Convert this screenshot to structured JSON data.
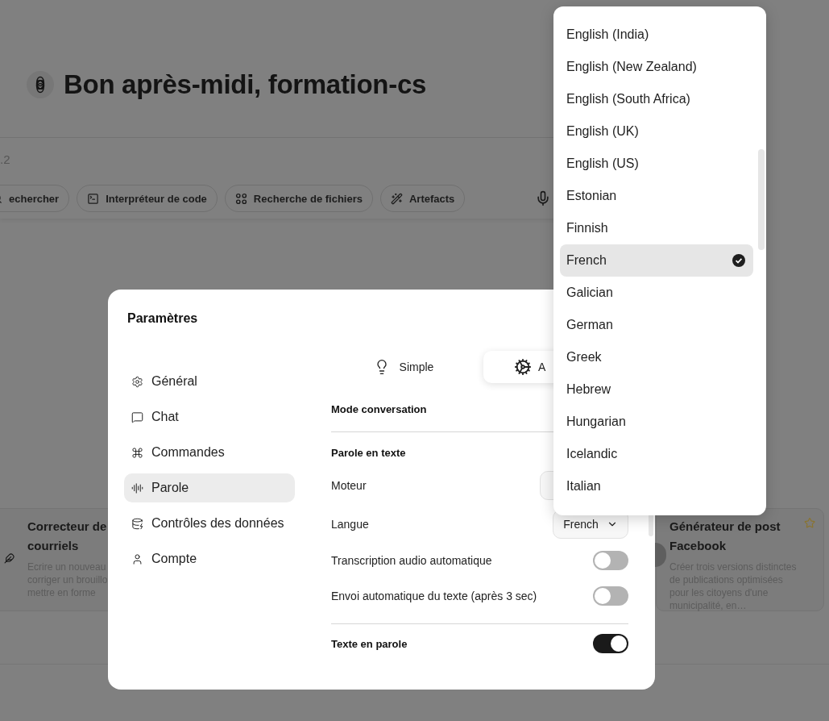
{
  "greeting": {
    "title": "Bon après-midi, formation-cs"
  },
  "composer": {
    "text": ".2",
    "tools": [
      {
        "label": "echercher",
        "kind": "search"
      },
      {
        "label": "Interpréteur de code",
        "kind": "terminal"
      },
      {
        "label": "Recherche de fichiers",
        "kind": "files"
      },
      {
        "label": "Artefacts",
        "kind": "wand"
      }
    ]
  },
  "cards": [
    {
      "kind": "pen",
      "title": "Correcteur de courriels",
      "description_lines": [
        "Ecrire un nouveau",
        "corriger un brouillo",
        "mettre en forme"
      ]
    },
    {
      "kind": "avatar",
      "title": "Générateur de post Facebook",
      "description_lines": [
        "Créer trois versions distinctes de publications optimisées pour les citoyens d'une municipalité, en…"
      ]
    }
  ],
  "settings": {
    "title": "Paramètres",
    "nav": [
      {
        "label": "Général",
        "kind": "general",
        "selected": false
      },
      {
        "label": "Chat",
        "kind": "chat",
        "selected": false
      },
      {
        "label": "Commandes",
        "kind": "commands",
        "selected": false
      },
      {
        "label": "Parole",
        "kind": "speech",
        "selected": true
      },
      {
        "label": "Contrôles des données",
        "kind": "data",
        "selected": false
      },
      {
        "label": "Compte",
        "kind": "account",
        "selected": false
      }
    ],
    "tabs": [
      {
        "label": "Simple",
        "kind": "bulb",
        "selected": false
      },
      {
        "label": "A",
        "kind": "gear",
        "selected": true
      }
    ],
    "rows": [
      {
        "kind": "section",
        "label": "Mode conversation"
      },
      {
        "kind": "section",
        "label": "Parole en texte",
        "divider_before": true
      },
      {
        "kind": "select",
        "label": "Moteur"
      },
      {
        "kind": "select",
        "label": "Langue",
        "value": "French"
      },
      {
        "kind": "toggle",
        "label": "Transcription audio automatique",
        "on": false
      },
      {
        "kind": "toggle",
        "label": "Envoi automatique du texte (après 3 sec)",
        "on": false
      },
      {
        "kind": "section_toggle",
        "label": "Texte en parole",
        "on": true,
        "divider_before": true
      }
    ]
  },
  "language_menu": {
    "items": [
      {
        "label": "English (India)",
        "selected": false
      },
      {
        "label": "English (New Zealand)",
        "selected": false
      },
      {
        "label": "English (South Africa)",
        "selected": false
      },
      {
        "label": "English (UK)",
        "selected": false
      },
      {
        "label": "English (US)",
        "selected": false
      },
      {
        "label": "Estonian",
        "selected": false
      },
      {
        "label": "Finnish",
        "selected": false
      },
      {
        "label": "French",
        "selected": true
      },
      {
        "label": "Galician",
        "selected": false
      },
      {
        "label": "German",
        "selected": false
      },
      {
        "label": "Greek",
        "selected": false
      },
      {
        "label": "Hebrew",
        "selected": false
      },
      {
        "label": "Hungarian",
        "selected": false
      },
      {
        "label": "Icelandic",
        "selected": false
      },
      {
        "label": "Italian",
        "selected": false
      }
    ]
  }
}
